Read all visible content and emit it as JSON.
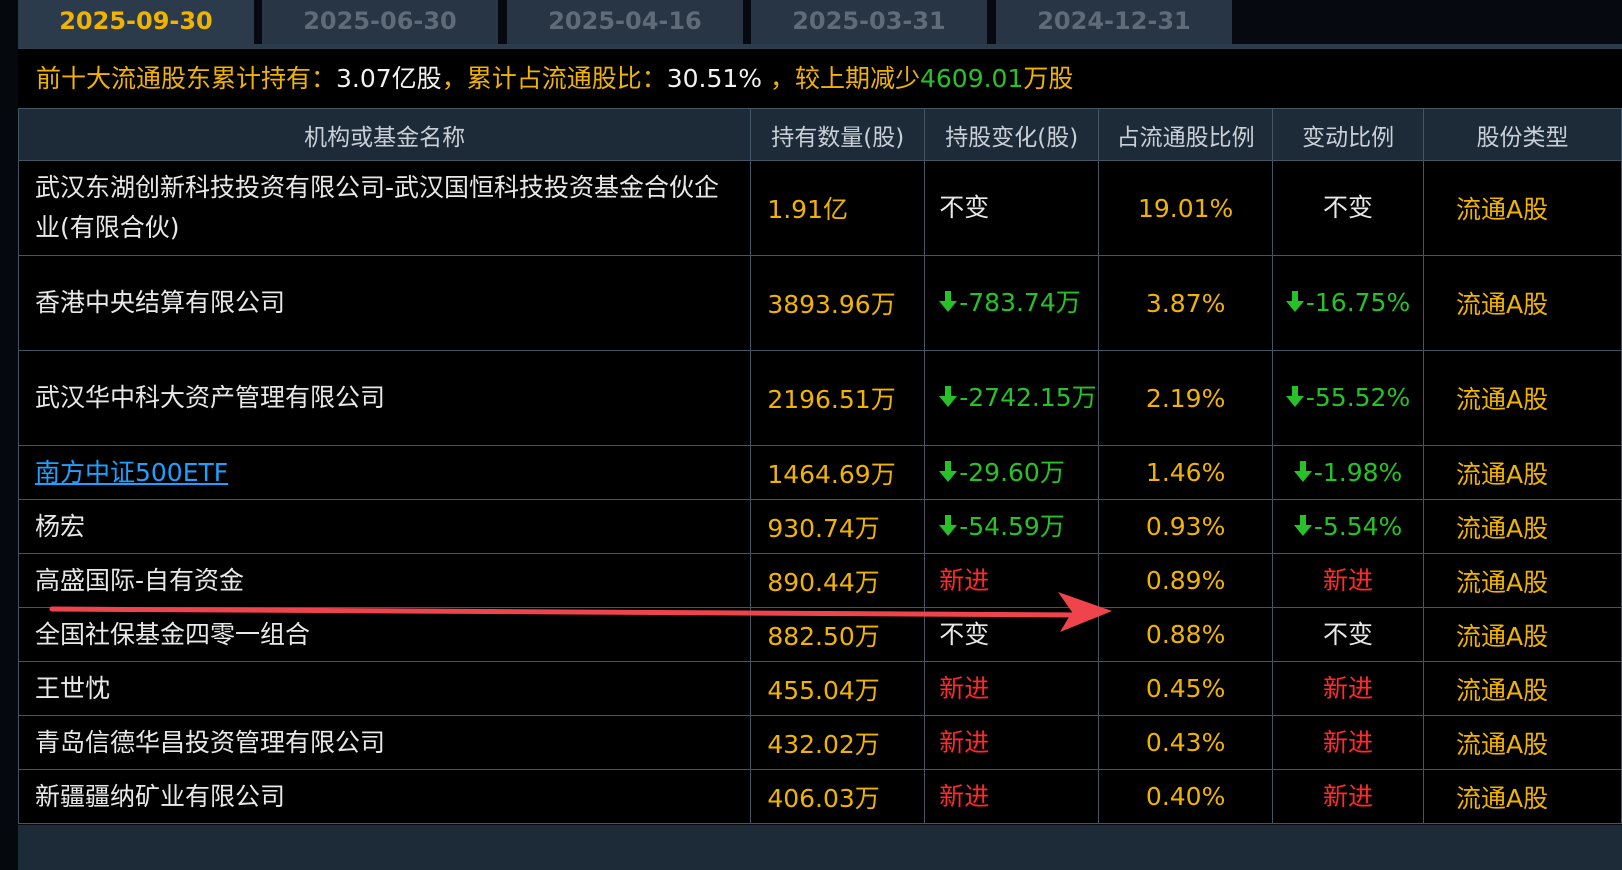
{
  "tabs": [
    "2025-09-30",
    "2025-06-30",
    "2025-04-16",
    "2025-03-31",
    "2024-12-31"
  ],
  "summary": {
    "label1": "前十大流通股东累计持有：",
    "value1": "3.07亿股",
    "label2": "，累计占流通股比：",
    "value2": "30.51%",
    "label3": " ，较上期减少",
    "value3": "4609.01",
    "unit3": "万股"
  },
  "table": {
    "headers": [
      "机构或基金名称",
      "持有数量(股)",
      "持股变化(股)",
      "占流通股比例",
      "变动比例",
      "股份类型"
    ],
    "rows": [
      {
        "name": "武汉东湖创新科技投资有限公司-武汉国恒科技投资基金合伙企业(有限合伙)",
        "link": false,
        "holding": "1.91亿",
        "change": "不变",
        "change_kind": "same",
        "pct": "19.01%",
        "ratio": "不变",
        "ratio_kind": "same",
        "type": "流通A股"
      },
      {
        "name": "香港中央结算有限公司",
        "link": false,
        "holding": "3893.96万",
        "change": "-783.74万",
        "change_kind": "down",
        "pct": "3.87%",
        "ratio": "-16.75%",
        "ratio_kind": "down",
        "type": "流通A股"
      },
      {
        "name": "武汉华中科大资产管理有限公司",
        "link": false,
        "holding": "2196.51万",
        "change": "-2742.15万",
        "change_kind": "down",
        "pct": "2.19%",
        "ratio": "-55.52%",
        "ratio_kind": "down",
        "type": "流通A股"
      },
      {
        "name": "南方中证500ETF",
        "link": true,
        "holding": "1464.69万",
        "change": "-29.60万",
        "change_kind": "down",
        "pct": "1.46%",
        "ratio": "-1.98%",
        "ratio_kind": "down",
        "type": "流通A股"
      },
      {
        "name": "杨宏",
        "link": false,
        "holding": "930.74万",
        "change": "-54.59万",
        "change_kind": "down",
        "pct": "0.93%",
        "ratio": "-5.54%",
        "ratio_kind": "down",
        "type": "流通A股"
      },
      {
        "name": "高盛国际-自有资金",
        "link": false,
        "holding": "890.44万",
        "change": "新进",
        "change_kind": "new",
        "pct": "0.89%",
        "ratio": "新进",
        "ratio_kind": "new",
        "type": "流通A股"
      },
      {
        "name": "全国社保基金四零一组合",
        "link": false,
        "holding": "882.50万",
        "change": "不变",
        "change_kind": "same",
        "pct": "0.88%",
        "ratio": "不变",
        "ratio_kind": "same",
        "type": "流通A股"
      },
      {
        "name": "王世忱",
        "link": false,
        "holding": "455.04万",
        "change": "新进",
        "change_kind": "new",
        "pct": "0.45%",
        "ratio": "新进",
        "ratio_kind": "new",
        "type": "流通A股"
      },
      {
        "name": "青岛信德华昌投资管理有限公司",
        "link": false,
        "holding": "432.02万",
        "change": "新进",
        "change_kind": "new",
        "pct": "0.43%",
        "ratio": "新进",
        "ratio_kind": "new",
        "type": "流通A股"
      },
      {
        "name": "新疆疆纳矿业有限公司",
        "link": false,
        "holding": "406.03万",
        "change": "新进",
        "change_kind": "new",
        "pct": "0.40%",
        "ratio": "新进",
        "ratio_kind": "new",
        "type": "流通A股"
      }
    ]
  },
  "colors": {
    "gold": "#f0b400",
    "green": "#27c227",
    "red": "#ff2a2a",
    "link": "#1fa0ff",
    "annotation_arrow": "#f0444c"
  },
  "annotation": {
    "icon": "red-arrow-icon"
  }
}
